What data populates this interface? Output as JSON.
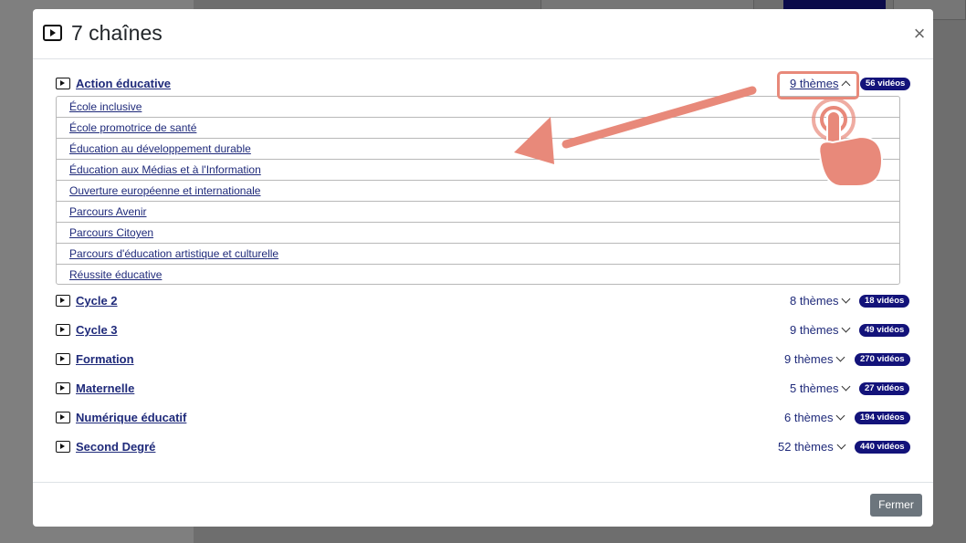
{
  "modal": {
    "title": "7 chaînes",
    "close_symbol": "×",
    "close_button_label": "Fermer"
  },
  "channels": [
    {
      "name": "Action éducative",
      "themes": "9 thèmes",
      "videos": "56 vidéos",
      "expanded": true,
      "theme_items": [
        "École inclusive",
        "École promotrice de santé",
        "Éducation au développement durable",
        "Éducation aux Médias et à l'Information",
        "Ouverture européenne et internationale",
        "Parcours Avenir",
        "Parcours Citoyen",
        "Parcours d'éducation artistique et culturelle",
        "Réussite éducative"
      ]
    },
    {
      "name": "Cycle 2",
      "themes": "8 thèmes",
      "videos": "18 vidéos",
      "expanded": false
    },
    {
      "name": "Cycle 3",
      "themes": "9 thèmes",
      "videos": "49 vidéos",
      "expanded": false
    },
    {
      "name": "Formation",
      "themes": "9 thèmes",
      "videos": "270 vidéos",
      "expanded": false
    },
    {
      "name": "Maternelle",
      "themes": "5 thèmes",
      "videos": "27 vidéos",
      "expanded": false
    },
    {
      "name": "Numérique éducatif",
      "themes": "6 thèmes",
      "videos": "194 vidéos",
      "expanded": false
    },
    {
      "name": "Second Degré",
      "themes": "52 thèmes",
      "videos": "440 vidéos",
      "expanded": false
    }
  ],
  "colors": {
    "link": "#1f2a7a",
    "badge": "#13137a",
    "highlight": "#e8897a",
    "close_button": "#6c757d"
  }
}
